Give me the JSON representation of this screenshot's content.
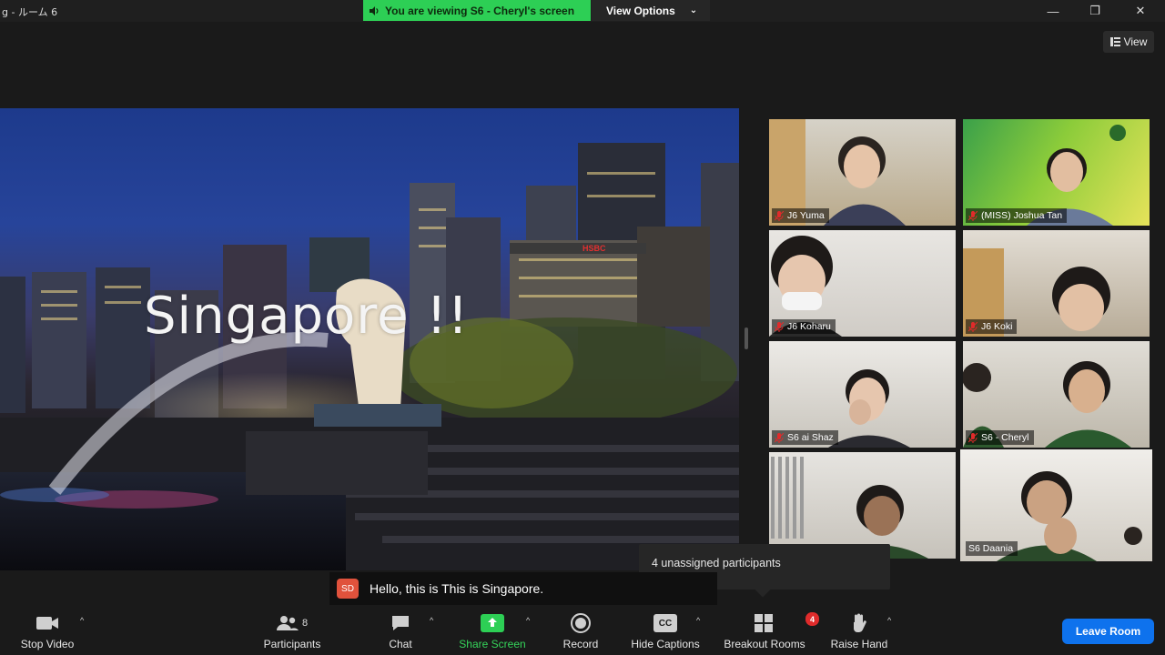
{
  "window": {
    "title": "g - ルーム 6",
    "viewing_banner": "You are viewing S6 - Cheryl's screen",
    "view_options": "View Options",
    "view_button": "View"
  },
  "shared_screen": {
    "slide_title": "Singapore !!",
    "sign_text": "HSBC"
  },
  "participants": [
    {
      "name": "J6 Yuma"
    },
    {
      "name": "(MISS) Joshua Tan"
    },
    {
      "name": "J6 Koharu"
    },
    {
      "name": "J6 Koki"
    },
    {
      "name": "S6 ai Shaz"
    },
    {
      "name": "S6 - Cheryl"
    },
    {
      "name": ""
    },
    {
      "name": "S6 Daania"
    }
  ],
  "popover": {
    "text": "4 unassigned participants"
  },
  "caption": {
    "speaker_initials": "SD",
    "text": "Hello, this is This is Singapore."
  },
  "toolbar": {
    "stop_video": "Stop Video",
    "participants": "Participants",
    "participants_count": "8",
    "chat": "Chat",
    "share_screen": "Share Screen",
    "record": "Record",
    "hide_captions": "Hide Captions",
    "cc_icon_text": "CC",
    "breakout_rooms": "Breakout Rooms",
    "breakout_badge": "4",
    "raise_hand": "Raise Hand",
    "leave_room": "Leave Room"
  },
  "colors": {
    "accent_green": "#2dcf55",
    "leave_blue": "#0e72ed",
    "active_speaker": "#c9e86a",
    "mic_muted": "#e02b2b"
  }
}
